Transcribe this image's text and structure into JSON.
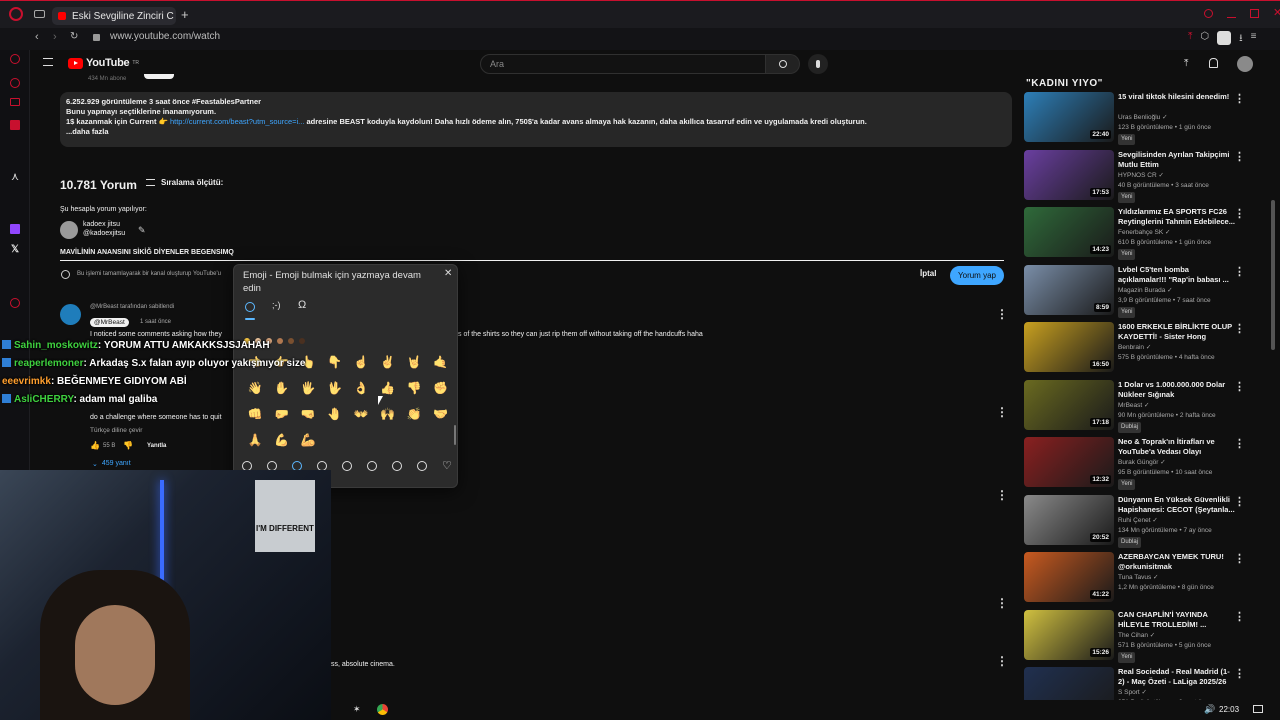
{
  "browser": {
    "tab_title": "Eski Sevgiline Zinciri C",
    "url": "www.youtube.com/watch"
  },
  "youtube": {
    "logo": "YouTube",
    "logo_superscript": "TR",
    "search_placeholder": "Ara",
    "channel_subs_partial": "434 Mn abone"
  },
  "description": {
    "stats": "6.252.929 görüntüleme  3 saat önce  #FeastablesPartner",
    "line1": "Bunu yapmayı seçtiklerine inanamıyorum.",
    "line2_prefix": "1$ kazanmak için Current 👉 ",
    "line2_link": "http://current.com/beast?utm_source=i...",
    "line2_suffix": " adresine BEAST koduyla kaydolun! Daha hızlı ödeme alın, 750$'a kadar avans almaya hak kazanın, daha akıllıca tasarruf edin ve uygulamada kredi oluşturun.",
    "more": "...daha fazla"
  },
  "comments": {
    "count": "10.781 Yorum",
    "sort_label": "Sıralama ölçütü:",
    "posting_as": "Şu hesapla yorum yapılıyor:",
    "account_name": "kadoex jitsu",
    "account_handle": "@kadoexjitsu",
    "draft_text": "MAVİLİNİN ANANSINI SİKİĞ DİYENLER BEGENSIMQ",
    "notice": "Bu işlemi tamamlayarak bir kanal oluşturup YouTube'u",
    "cancel": "İptal",
    "post": "Yorum yap",
    "pinned_by": "@MrBeast tarafından sabitlendi",
    "pinned_author": "@MrBeast",
    "pinned_time": "1 saat önce",
    "pinned_text_start": "I noticed some comments asking how they",
    "pinned_text_end": "s of the shirts so they can just rip them off without taking off the handcuffs haha",
    "second_text": "do a challenge where someone has to quit",
    "translate": "Türkçe diline çevir",
    "likes": "55 B",
    "reply": "Yanıtla",
    "replies": "459 yanıt",
    "bottom_text": "ss, absolute cinema."
  },
  "emoji_panel": {
    "title": "Emoji - Emoji bulmak için yazmaya devam edin",
    "tabs": [
      "smiley-icon",
      "kaomoji-icon",
      "symbols-icon"
    ],
    "skin_tones": [
      "#f5c542",
      "#f0c8a0",
      "#d4a27a",
      "#b07850",
      "#7a5030",
      "#4a3020"
    ],
    "emojis": [
      [
        "👈",
        "👉",
        "👆",
        "👇",
        "☝",
        "✌",
        "🤘",
        "🤙",
        "👋"
      ],
      [
        "✋",
        "🖐",
        "🖖",
        "👌",
        "👍",
        "👎",
        "✊",
        "👊",
        "🤛",
        "🤜"
      ],
      [
        "🤚",
        "👐",
        "🙌",
        "👏",
        "🤝",
        "🙏",
        "💪",
        "🦾"
      ],
      [
        "🙏",
        "🤲",
        "💅"
      ]
    ],
    "categories": [
      "search-icon",
      "recent-icon",
      "smiley-icon",
      "people-icon",
      "nature-icon",
      "food-icon",
      "flag-icon",
      "car-icon",
      "heart-icon"
    ]
  },
  "chat": [
    {
      "user": "Sahin_moskowitz",
      "color": "#3fd13f",
      "text": ": YORUM ATTU AMKAKKSJSJAHAH"
    },
    {
      "user": "reaperlemoner",
      "color": "#3fd13f",
      "text": ": Arkadaş S.x falan ayıp oluyor yakışmıyor size"
    },
    {
      "user": "eeevrimkk",
      "color": "#ff9f2e",
      "text": ": BEĞENMEYE GIDIYOM ABİ"
    },
    {
      "user": "AsliCHERRY",
      "color": "#3fd13f",
      "text": ": adam mal galiba"
    }
  ],
  "webcam": {
    "poster_text": "I'M DIFFERENT"
  },
  "sidebar": {
    "header": "\"KADINI YIYO\"",
    "videos": [
      {
        "title": "15 viral tiktok hilesini denedim!",
        "channel": "Uras Benlioğlu",
        "meta": "123 B görüntüleme • 1 gün önce",
        "badge": "Yeni",
        "duration": "22:40",
        "thumb": "#2d7fb8"
      },
      {
        "title": "Sevgilisinden Ayrılan Takipçimi Mutlu Ettim",
        "channel": "HYPNOS CR",
        "meta": "40 B görüntüleme • 3 saat önce",
        "badge": "Yeni",
        "duration": "17:53",
        "thumb": "#6a3fa0"
      },
      {
        "title": "Yıldızlarımız EA SPORTS FC26 Reytinglerini Tahmin Edebilece...",
        "channel": "Fenerbahçe SK",
        "meta": "610 B görüntüleme • 1 gün önce",
        "badge": "Yeni",
        "duration": "14:23",
        "thumb": "#2f6a3a"
      },
      {
        "title": "Lvbel C5'ten bomba açıklamalar!!! \"Rap'in babası ...",
        "channel": "Magazin Burada",
        "meta": "3,9 B görüntüleme • 7 saat önce",
        "badge": "Yeni",
        "duration": "8:59",
        "thumb": "#7a8ea8"
      },
      {
        "title": "1600 ERKEKLE BİRLİKTE OLUP KAYDETTİ! - Sister Hong",
        "channel": "Benbrain",
        "meta": "575 B görüntüleme • 4 hafta önce",
        "badge": "",
        "duration": "16:50",
        "thumb": "#c8a020"
      },
      {
        "title": "1 Dolar vs 1.000.000.000 Dolar Nükleer Sığınak",
        "channel": "MrBeast",
        "meta": "90 Mn görüntüleme • 2 hafta önce",
        "badge": "Dublaj",
        "duration": "17:18",
        "thumb": "#6a6a20"
      },
      {
        "title": "Neo & Toprak'ın İtirafları ve YouTube'a Vedası Olayı",
        "channel": "Burak Güngör",
        "meta": "95 B görüntüleme • 10 saat önce",
        "badge": "Yeni",
        "duration": "12:32",
        "thumb": "#8a2020"
      },
      {
        "title": "Dünyanın En Yüksek Güvenlikli Hapishanesi: CECOT (Şeytanla...",
        "channel": "Ruhi Çenet",
        "meta": "134 Mn görüntüleme • 7 ay önce",
        "badge": "Dublaj",
        "duration": "20:52",
        "thumb": "#8a8a8a"
      },
      {
        "title": "AZERBAYCAN YEMEK TURU! @orkunisitmak",
        "channel": "Tuna Tavus",
        "meta": "1,2 Mn görüntüleme • 8 gün önce",
        "badge": "",
        "duration": "41:22",
        "thumb": "#c85a20"
      },
      {
        "title": "CAN CHAPLİN'İ YAYINDA HİLEYLE TROLLEDİM! ...",
        "channel": "The Cihan",
        "meta": "571 B görüntüleme • 5 gün önce",
        "badge": "Yeni",
        "duration": "15:26",
        "thumb": "#d0c040"
      },
      {
        "title": "Real Sociedad - Real Madrid (1-2) - Maç Özeti - LaLiga 2025/26",
        "channel": "S Sport",
        "meta": "251 B görüntüleme • 2 saat önce",
        "badge": "",
        "duration": "",
        "thumb": "#203050"
      }
    ]
  },
  "taskbar": {
    "time": "22:03"
  }
}
